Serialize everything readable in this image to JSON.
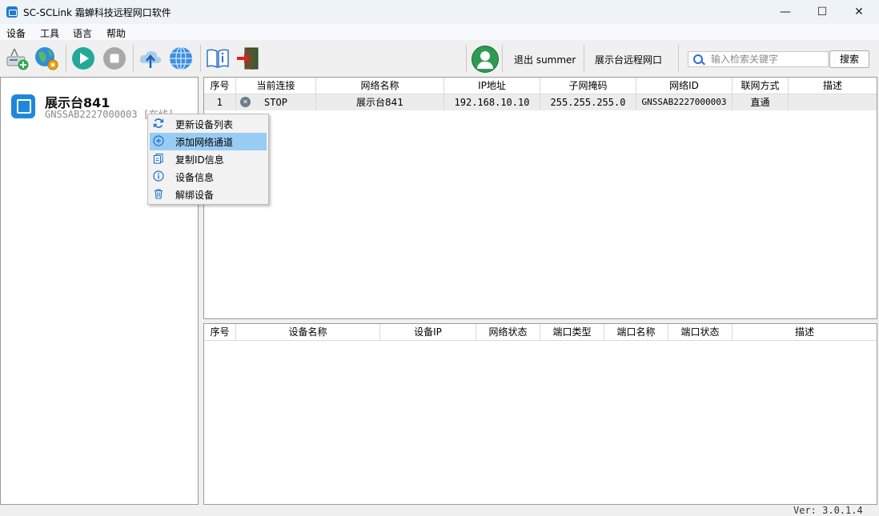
{
  "window": {
    "title": "SC-SCLink 霜蝉科技远程网口软件",
    "minimize": "—",
    "maximize": "☐",
    "close": "✕"
  },
  "menu": [
    "设备",
    "工具",
    "语言",
    "帮助"
  ],
  "toolbar": {
    "logout_label": "退出 summer",
    "remote_label": "展示台远程网口",
    "search": {
      "placeholder": "输入检索关键字",
      "value": ""
    },
    "search_button": "搜索",
    "icons": [
      "add-device-icon",
      "network-config-icon",
      "start-icon",
      "stop-icon",
      "upload-icon",
      "globe-icon",
      "manual-icon",
      "exit-icon",
      "user-avatar-icon"
    ]
  },
  "device_list": [
    {
      "name": "展示台841",
      "id_status": "GNSSAB2227000003 [在线]"
    }
  ],
  "context_menu": {
    "items": [
      {
        "label": "更新设备列表",
        "icon": "refresh-icon"
      },
      {
        "label": "添加网络通道",
        "icon": "add-circle-icon",
        "selected": true
      },
      {
        "label": "复制ID信息",
        "icon": "copy-icon"
      },
      {
        "label": "设备信息",
        "icon": "info-icon"
      },
      {
        "label": "解绑设备",
        "icon": "trash-icon"
      }
    ]
  },
  "networks_table": {
    "columns": [
      "序号",
      "当前连接",
      "网络名称",
      "IP地址",
      "子网掩码",
      "网络ID",
      "联网方式",
      "描述"
    ],
    "rows": [
      [
        "1",
        "STOP",
        "展示台841",
        "192.168.10.10",
        "255.255.255.0",
        "GNSSAB2227000003",
        "直通",
        ""
      ]
    ]
  },
  "ports_table": {
    "columns": [
      "序号",
      "设备名称",
      "设备IP",
      "网络状态",
      "端口类型",
      "端口名称",
      "端口状态",
      "描述"
    ],
    "rows": []
  },
  "status": {
    "version": "Ver: 3.0.1.4"
  },
  "colors": {
    "accent": "#1f88d9",
    "selection": "#99ccf3",
    "avatar": "#2e9a53"
  }
}
